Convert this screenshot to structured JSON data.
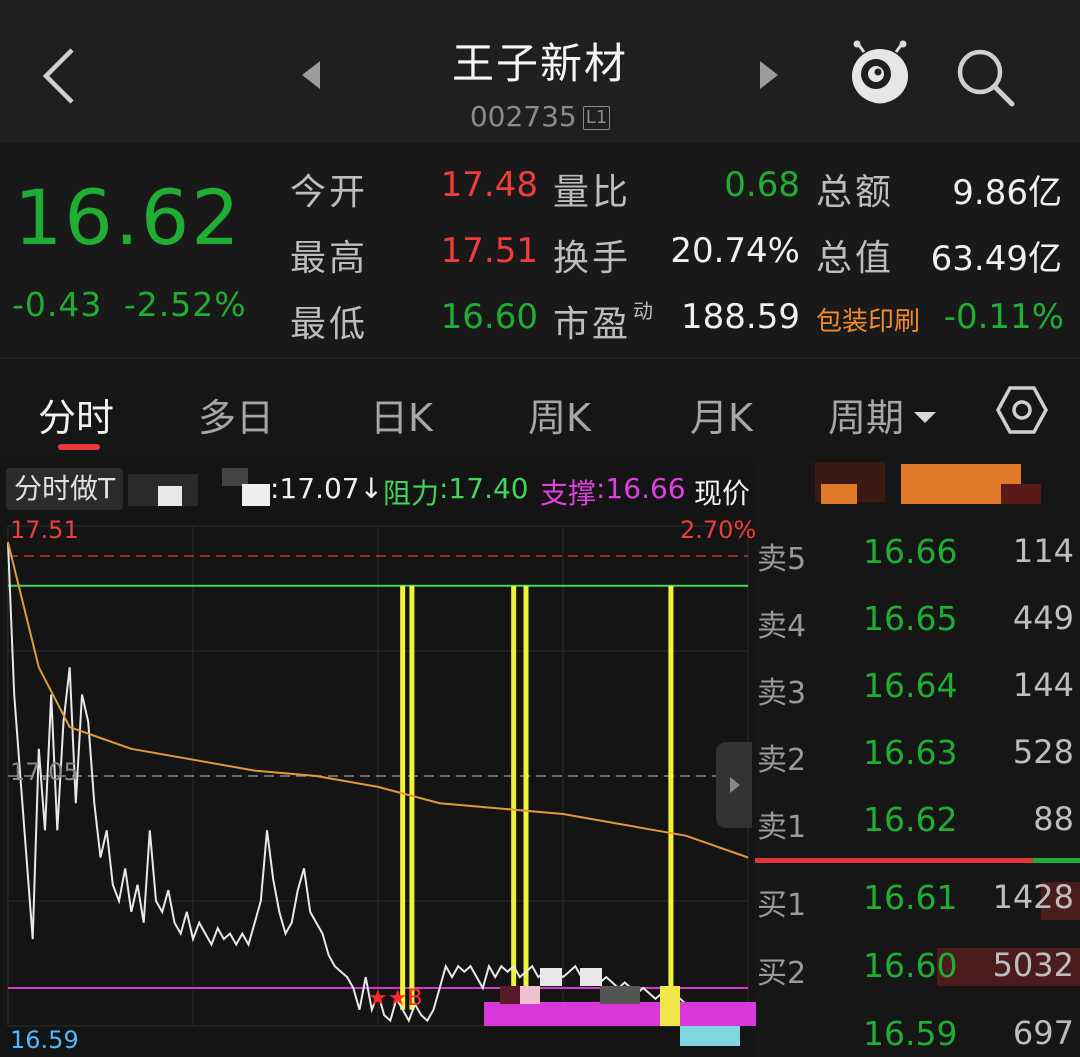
{
  "header": {
    "stock_name": "王子新材",
    "stock_code": "002735",
    "level_badge": "L1",
    "icons": [
      "back-icon",
      "prev-stock-icon",
      "next-stock-icon",
      "mascot-icon",
      "search-icon"
    ]
  },
  "quote": {
    "price": "16.62",
    "change": "-0.43",
    "change_pct": "-2.52%",
    "stats": [
      {
        "label": "今开",
        "value": "17.48"
      },
      {
        "label": "量比",
        "value": "0.68"
      },
      {
        "label": "总额",
        "value": "9.86亿"
      },
      {
        "label": "最高",
        "value": "17.51"
      },
      {
        "label": "换手",
        "value": "20.74%"
      },
      {
        "label": "总值",
        "value": "63.49亿"
      },
      {
        "label": "最低",
        "value": "16.60"
      },
      {
        "label": "市盈",
        "value": "188.59",
        "superscript": "动"
      },
      {
        "label": "包装印刷",
        "value": "-0.11%"
      }
    ]
  },
  "tabs": {
    "items": [
      "分时",
      "多日",
      "日K",
      "周K",
      "月K",
      "周期"
    ],
    "active": "分时"
  },
  "indicator": {
    "name": "分时做T",
    "ref_value": ":17.07↓",
    "resistance_label": "阻力",
    "resistance_value": ":17.40",
    "support_label": "支撑",
    "support_value": ":16.66",
    "current_label": "现价"
  },
  "chart_data": {
    "type": "line",
    "title": "",
    "y_top_label": "17.51",
    "y_mid_label": "17.05",
    "y_bottom_label": "16.59",
    "pct_top_label": "2.70%",
    "ylim": [
      16.59,
      17.51
    ],
    "pre_close": 17.05,
    "resistance": 17.4,
    "support": 16.66,
    "marker_text": "B",
    "series": [
      {
        "name": "",
        "color": "#e8e8e8",
        "x": [
          0,
          2,
          4,
          6,
          8,
          10,
          12,
          14,
          16,
          18,
          20,
          22,
          24,
          26,
          28,
          30,
          32,
          34,
          36,
          38,
          40,
          42,
          44,
          46,
          48,
          50,
          52,
          54,
          56,
          58,
          60,
          62,
          64,
          66,
          68,
          70,
          72,
          74,
          76,
          78,
          80,
          82,
          84,
          86,
          88,
          90,
          92,
          94,
          96,
          98,
          100,
          102,
          104,
          106,
          108,
          110,
          112,
          114,
          116,
          118,
          120,
          122,
          124,
          126,
          128,
          130,
          132,
          134,
          136,
          138,
          140,
          142,
          144,
          146,
          148,
          150,
          152,
          154,
          156,
          158,
          160,
          162,
          164,
          166,
          168,
          170,
          172,
          174,
          176,
          178,
          180,
          182,
          184,
          186,
          188,
          190,
          192,
          194,
          196,
          198,
          200,
          202,
          204,
          206,
          208,
          210,
          212,
          214,
          216,
          218,
          220,
          222,
          224,
          226,
          228,
          230,
          232,
          234,
          236,
          238,
          240
        ],
        "values": [
          17.48,
          17.2,
          17.05,
          16.9,
          16.75,
          17.1,
          16.95,
          17.2,
          16.95,
          17.15,
          17.25,
          17.0,
          17.2,
          17.15,
          17.0,
          16.9,
          16.95,
          16.85,
          16.82,
          16.88,
          16.8,
          16.85,
          16.78,
          16.95,
          16.82,
          16.8,
          16.84,
          16.78,
          16.76,
          16.8,
          16.75,
          16.78,
          16.76,
          16.74,
          16.77,
          16.75,
          16.76,
          16.74,
          16.76,
          16.74,
          16.78,
          16.82,
          16.95,
          16.86,
          16.8,
          16.76,
          16.78,
          16.84,
          16.88,
          16.8,
          16.78,
          16.76,
          16.72,
          16.7,
          16.69,
          16.68,
          16.66,
          16.62,
          16.68,
          16.62,
          16.65,
          16.61,
          16.6,
          16.64,
          16.62,
          16.6,
          16.63,
          16.61,
          16.6,
          16.62,
          16.66,
          16.7,
          16.68,
          16.7,
          16.69,
          16.7,
          16.68,
          16.66,
          16.7,
          16.68,
          16.7,
          16.69,
          16.7,
          16.68,
          16.69,
          16.7,
          16.68,
          16.69,
          16.68,
          16.69,
          16.68,
          16.69,
          16.7,
          16.68,
          16.69,
          16.68,
          16.67,
          16.68,
          16.67,
          16.66,
          16.67,
          16.66,
          16.65,
          16.66,
          16.65,
          16.64,
          16.65,
          16.64,
          16.63,
          16.64,
          16.63,
          16.62,
          16.63,
          16.62,
          16.62,
          16.62,
          16.62,
          16.62,
          16.62,
          16.62,
          16.62
        ]
      },
      {
        "name": "",
        "color": "#e09a3a",
        "x": [
          0,
          10,
          20,
          30,
          40,
          60,
          80,
          100,
          120,
          140,
          160,
          180,
          200,
          220,
          240
        ],
        "values": [
          17.48,
          17.25,
          17.14,
          17.12,
          17.1,
          17.08,
          17.06,
          17.05,
          17.03,
          17.0,
          16.99,
          16.98,
          16.96,
          16.94,
          16.9
        ]
      }
    ],
    "yellow_bars_x": [
      128,
      131,
      164,
      168,
      215
    ]
  },
  "orderbook": {
    "rows": [
      {
        "label": "卖5",
        "price": "16.66",
        "volume": "114"
      },
      {
        "label": "卖4",
        "price": "16.65",
        "volume": "449"
      },
      {
        "label": "卖3",
        "price": "16.64",
        "volume": "144"
      },
      {
        "label": "卖2",
        "price": "16.63",
        "volume": "528"
      },
      {
        "label": "卖1",
        "price": "16.62",
        "volume": "88"
      },
      {
        "label": "买1",
        "price": "16.61",
        "volume": "1428",
        "bar_ratio": 0.12
      },
      {
        "label": "买2",
        "price": "16.60",
        "volume": "5032",
        "bar_ratio": 0.44
      },
      {
        "label": "",
        "price": "16.59",
        "volume": "697"
      }
    ],
    "buy_sell_ratio": 0.86
  },
  "colors": {
    "up": "#ef3c3c",
    "down": "#1fae33",
    "avg_line": "#e09a3a",
    "resistance": "#3fd65a",
    "support": "#d23ad2",
    "sector": "#f08a2a"
  }
}
